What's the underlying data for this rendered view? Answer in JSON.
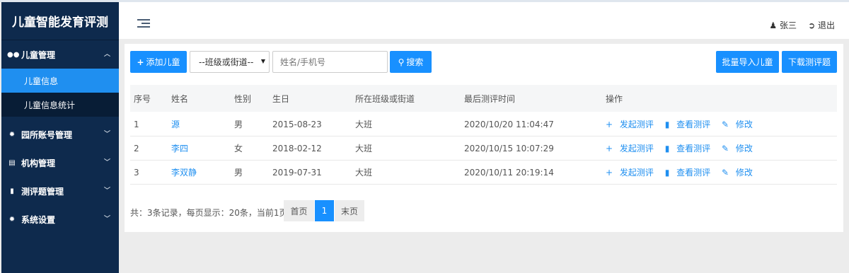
{
  "app": {
    "title": "儿童智能发育评测"
  },
  "sidebar": {
    "items": [
      {
        "label": "儿童管理",
        "icon": "users-icon",
        "chevron": "︿",
        "children": [
          {
            "label": "儿童信息"
          },
          {
            "label": "儿童信息统计"
          }
        ]
      },
      {
        "label": "园所账号管理",
        "icon": "gear-icon",
        "chevron": "﹀"
      },
      {
        "label": "机构管理",
        "icon": "institution-icon",
        "chevron": "﹀"
      },
      {
        "label": "测评题管理",
        "icon": "document-icon",
        "chevron": "﹀"
      },
      {
        "label": "系统设置",
        "icon": "gear-icon",
        "chevron": "﹀"
      }
    ]
  },
  "header": {
    "user": "张三",
    "logout": "退出"
  },
  "toolbar": {
    "add_child": "添加儿童",
    "class_select": "--班级或街道--",
    "search_placeholder": "姓名/手机号",
    "search": "搜索",
    "batch_import": "批量导入儿童",
    "download": "下载测评题"
  },
  "table": {
    "columns": [
      "序号",
      "姓名",
      "性别",
      "生日",
      "所在班级或街道",
      "最后测评时间",
      "操作"
    ],
    "rows": [
      {
        "no": "1",
        "name": "源",
        "gender": "男",
        "birthday": "2015-08-23",
        "class": "大班",
        "last_eval": "2020/10/20 11:04:47"
      },
      {
        "no": "2",
        "name": "李四",
        "gender": "女",
        "birthday": "2018-02-12",
        "class": "大班",
        "last_eval": "2020/10/15 10:07:29"
      },
      {
        "no": "3",
        "name": "李双静",
        "gender": "男",
        "birthday": "2019-07-31",
        "class": "大班",
        "last_eval": "2020/10/11 20:19:14"
      }
    ],
    "actions": {
      "start": "发起测评",
      "view": "查看测评",
      "edit": "修改"
    }
  },
  "pagination": {
    "info": "共：3条记录，每页显示：20条，当前1页",
    "first": "首页",
    "current": "1",
    "last": "末页"
  },
  "colors": {
    "sidebar": "#0e2a4d",
    "accent": "#1890ff"
  }
}
